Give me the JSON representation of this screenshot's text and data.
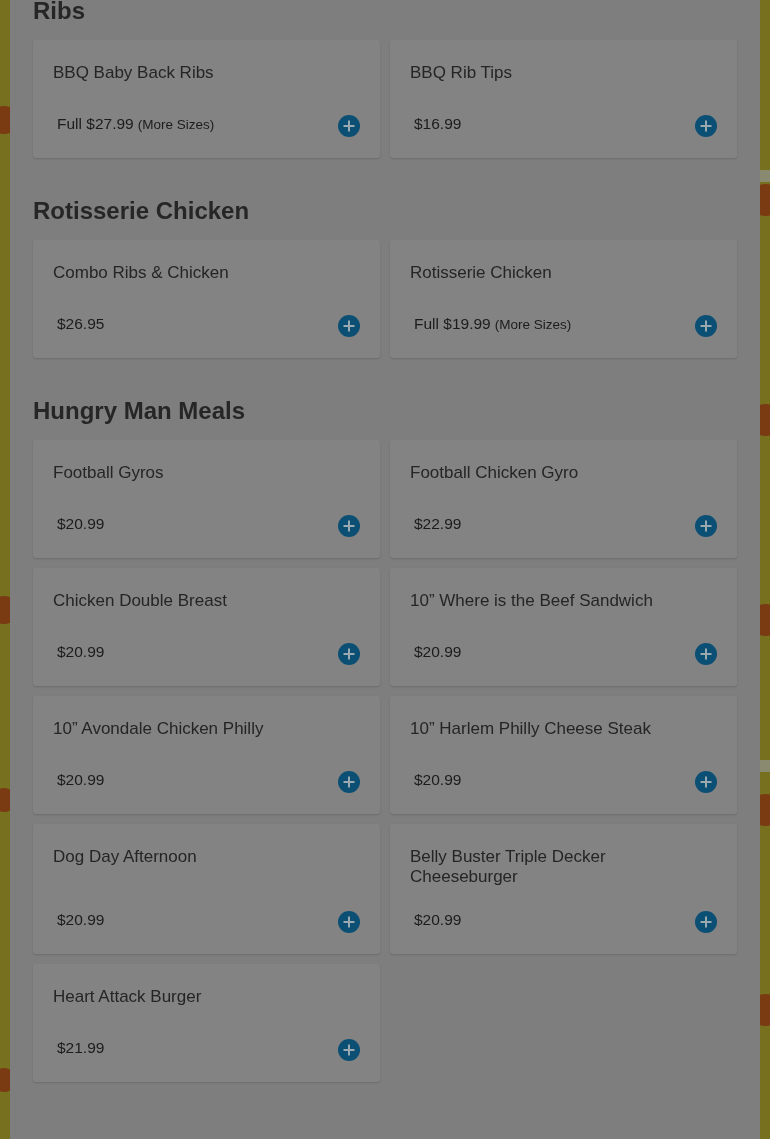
{
  "sections": [
    {
      "title": "Ribs",
      "items": [
        {
          "name": "BBQ Baby Back Ribs",
          "price": "Full $27.99",
          "more": "(More Sizes)"
        },
        {
          "name": "BBQ Rib Tips",
          "price": "$16.99"
        }
      ]
    },
    {
      "title": "Rotisserie Chicken",
      "items": [
        {
          "name": "Combo Ribs & Chicken",
          "price": "$26.95"
        },
        {
          "name": "Rotisserie Chicken",
          "price": "Full $19.99",
          "more": "(More Sizes)"
        }
      ]
    },
    {
      "title": "Hungry Man Meals",
      "items": [
        {
          "name": "Football Gyros",
          "price": "$20.99"
        },
        {
          "name": "Football Chicken Gyro",
          "price": "$22.99"
        },
        {
          "name": "Chicken Double Breast",
          "price": "$20.99"
        },
        {
          "name": "10” Where is the Beef Sandwich",
          "price": "$20.99"
        },
        {
          "name": "10” Avondale Chicken Philly",
          "price": "$20.99"
        },
        {
          "name": "10” Harlem Philly Cheese Steak",
          "price": "$20.99"
        },
        {
          "name": "Dog Day Afternoon",
          "price": "$20.99"
        },
        {
          "name": "Belly Buster Triple Decker Cheeseburger",
          "price": "$20.99"
        },
        {
          "name": "Heart Attack Burger",
          "price": "$21.99"
        }
      ]
    }
  ]
}
